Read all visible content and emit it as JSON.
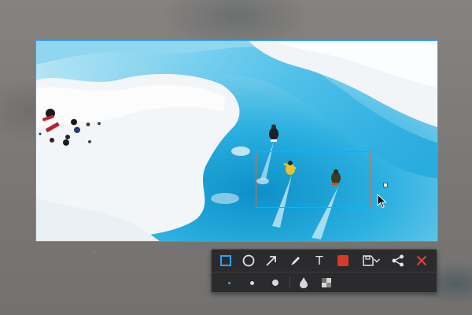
{
  "screen": {
    "description_hidden": ""
  },
  "toolbar": {
    "tools": [
      {
        "name": "rectangle",
        "icon": "rectangle-icon",
        "active": true
      },
      {
        "name": "ellipse",
        "icon": "circle-icon"
      },
      {
        "name": "arrow",
        "icon": "arrow-icon"
      },
      {
        "name": "pen",
        "icon": "pencil-icon"
      },
      {
        "name": "text",
        "icon": "text-icon",
        "label": "T"
      },
      {
        "name": "color",
        "icon": "color-swatch",
        "color": "#d93a26"
      },
      {
        "name": "save",
        "icon": "save-icon"
      },
      {
        "name": "save-options",
        "icon": "chevron-down-icon"
      },
      {
        "name": "share",
        "icon": "share-icon"
      },
      {
        "name": "close",
        "icon": "close-icon",
        "color": "#e0443a"
      }
    ],
    "sizes": [
      "small",
      "medium",
      "large"
    ],
    "effects": [
      {
        "name": "blur",
        "icon": "drop-icon"
      },
      {
        "name": "mosaic",
        "icon": "mosaic-icon"
      }
    ]
  },
  "colors": {
    "selection_border": "#2ea2ff",
    "annotation_border": "#e06a3b",
    "active_tool": "#2ea2ff",
    "toolbar_bg": "#2b2b2d"
  }
}
